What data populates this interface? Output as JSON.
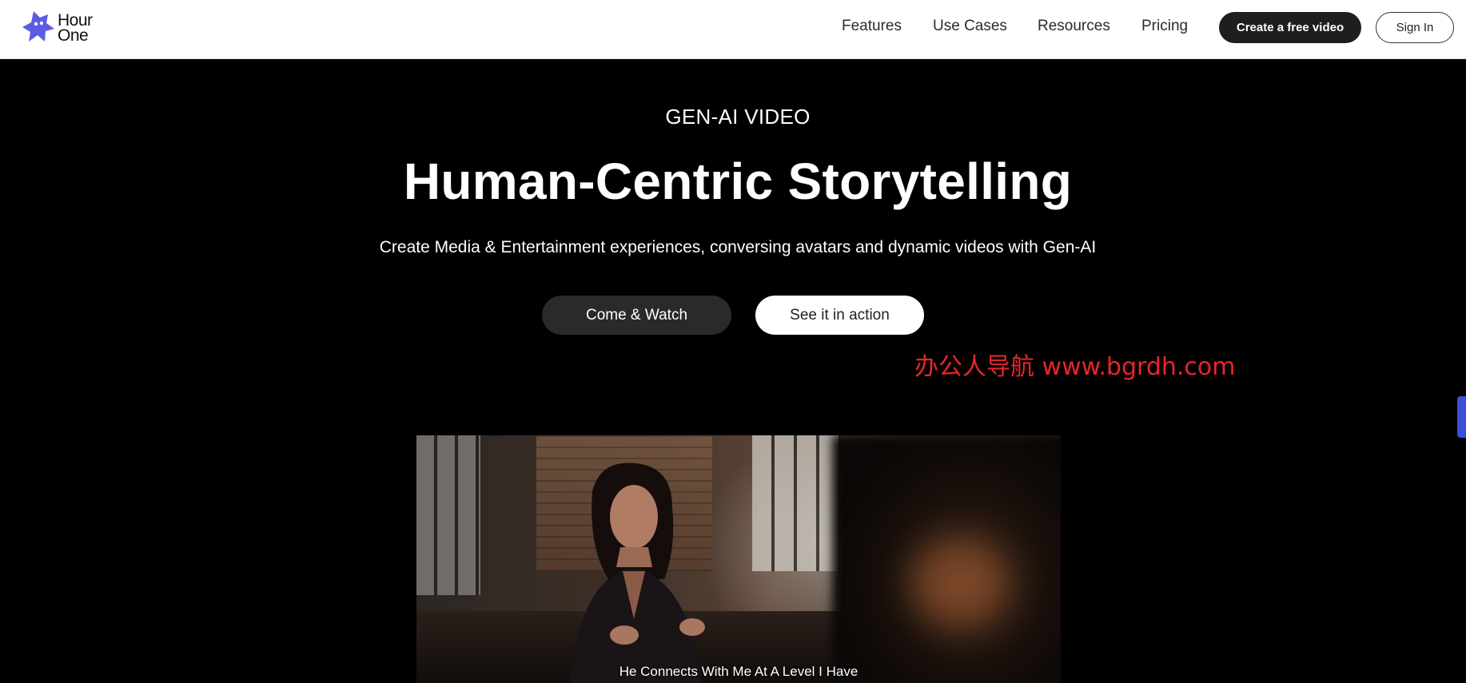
{
  "header": {
    "logo_text_line1": "Hour",
    "logo_text_line2": "One",
    "nav": [
      "Features",
      "Use Cases",
      "Resources",
      "Pricing"
    ],
    "cta_label": "Create a free video",
    "signin_label": "Sign In"
  },
  "hero": {
    "eyebrow": "GEN-AI VIDEO",
    "title": "Human-Centric Storytelling",
    "subtitle": "Create Media & Entertainment experiences, conversing avatars and dynamic videos with Gen-AI",
    "primary_button": "Come & Watch",
    "secondary_button": "See it in action"
  },
  "watermark": "办公人导航 www.bgrdh.com",
  "video": {
    "caption": "He Connects With Me At A Level I Have"
  },
  "colors": {
    "brand": "#5a5ae6",
    "side_tab": "#3a4fd6",
    "watermark": "#e8262a"
  }
}
